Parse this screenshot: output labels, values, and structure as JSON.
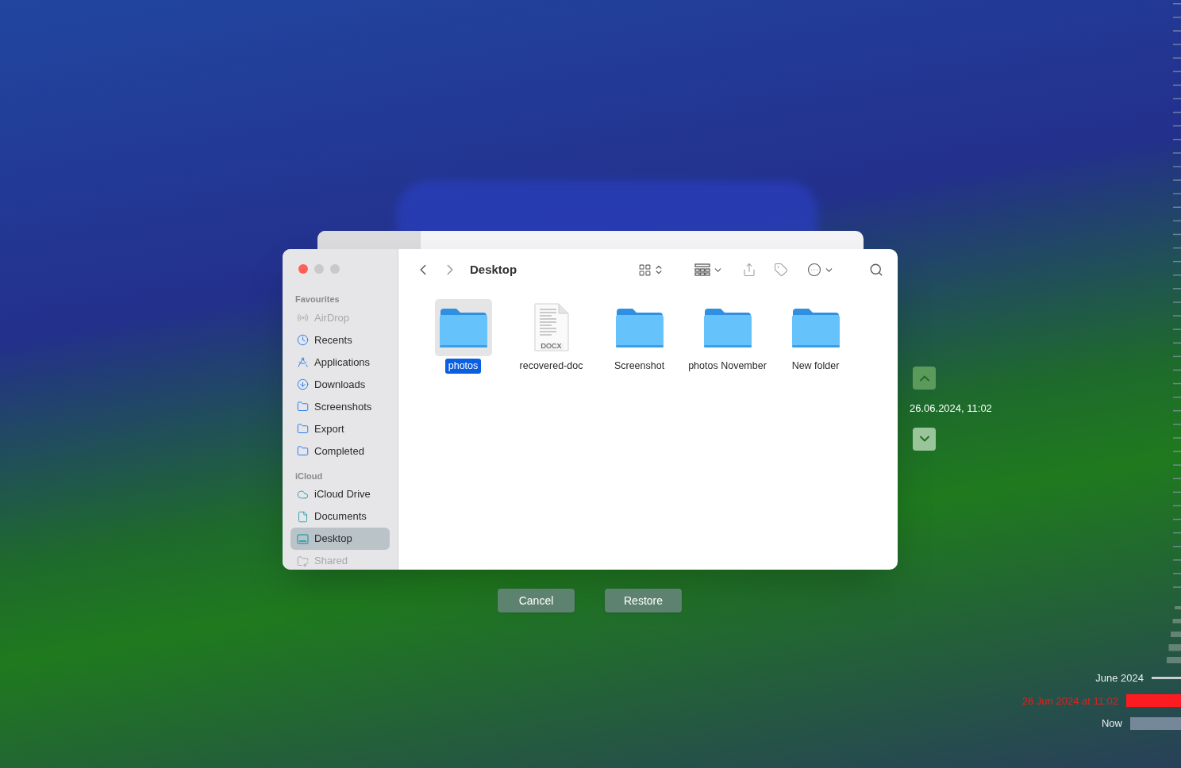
{
  "finder": {
    "window_title": "Desktop",
    "sidebar": [
      {
        "heading": "Favourites",
        "items": [
          {
            "label": "AirDrop",
            "kind": "airdrop",
            "disabled": true,
            "selected": false
          },
          {
            "label": "Recents",
            "kind": "clock",
            "disabled": false,
            "selected": false
          },
          {
            "label": "Applications",
            "kind": "apps",
            "disabled": false,
            "selected": false
          },
          {
            "label": "Downloads",
            "kind": "download",
            "disabled": false,
            "selected": false
          },
          {
            "label": "Screenshots",
            "kind": "folder",
            "disabled": false,
            "selected": false
          },
          {
            "label": "Export",
            "kind": "folder",
            "disabled": false,
            "selected": false
          },
          {
            "label": "Completed",
            "kind": "folder",
            "disabled": false,
            "selected": false
          }
        ]
      },
      {
        "heading": "iCloud",
        "items": [
          {
            "label": "iCloud Drive",
            "kind": "cloud",
            "disabled": false,
            "selected": false
          },
          {
            "label": "Documents",
            "kind": "doc",
            "disabled": false,
            "selected": false
          },
          {
            "label": "Desktop",
            "kind": "desktop",
            "disabled": false,
            "selected": true
          },
          {
            "label": "Shared",
            "kind": "shared",
            "disabled": true,
            "selected": false
          }
        ]
      }
    ],
    "files": [
      {
        "name": "photos",
        "kind": "folder",
        "selected": true
      },
      {
        "name": "recovered-doc",
        "kind": "document",
        "badge": "DOCX",
        "selected": false
      },
      {
        "name": "Screenshot",
        "kind": "folder",
        "selected": false
      },
      {
        "name": "photos November",
        "kind": "folder",
        "selected": false
      },
      {
        "name": "New folder",
        "kind": "folder",
        "selected": false
      }
    ]
  },
  "date_navigator": {
    "date": "26.06.2024, 11:02"
  },
  "buttons": [
    {
      "label": "Cancel"
    },
    {
      "label": "Restore"
    }
  ],
  "timeline": [
    {
      "label": "June 2024",
      "kind": "month",
      "selected": false
    },
    {
      "label": "26 Jun 2024 at 11:02",
      "kind": "snapshot",
      "selected": true
    },
    {
      "label": "Now",
      "kind": "snapshot",
      "selected": false
    }
  ]
}
